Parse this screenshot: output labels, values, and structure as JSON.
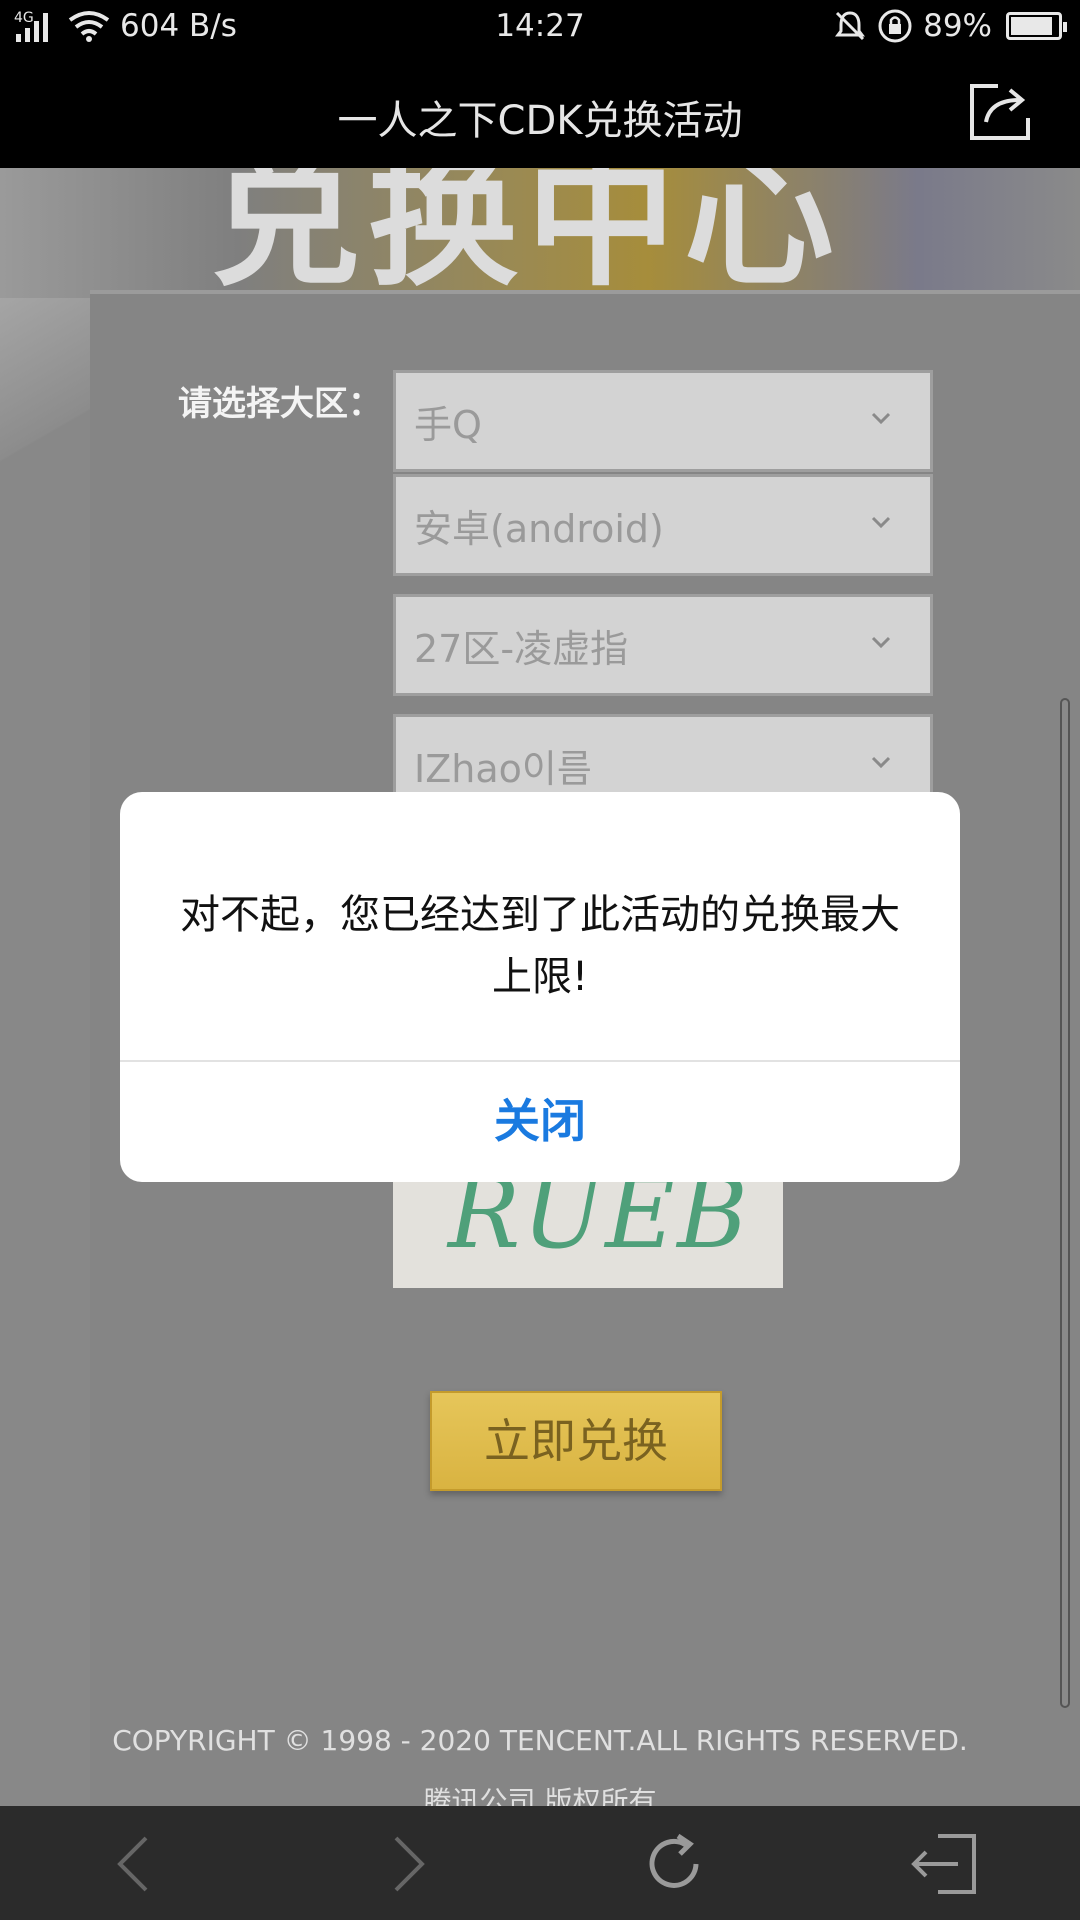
{
  "status_bar": {
    "network_type": "4G",
    "speed": "604 B/s",
    "time": "14:27",
    "battery_percent": "89%",
    "battery_level": 0.89,
    "icons": [
      "signal-icon",
      "wifi-icon",
      "mute-icon",
      "lock-rotation-icon",
      "battery-icon"
    ]
  },
  "title_bar": {
    "title": "一人之下CDK兑换活动",
    "share_icon": "share-icon"
  },
  "form": {
    "region_label": "请选择大区：",
    "selects": [
      {
        "value": "手Q"
      },
      {
        "value": "安卓(android)"
      },
      {
        "value": "27区-凌虚指"
      },
      {
        "value": "IZhao이름"
      }
    ],
    "captcha_text": "RUEB",
    "redeem_button": "立即兑换"
  },
  "footer": {
    "copyright": "COPYRIGHT © 1998 - 2020 TENCENT.ALL RIGHTS RESERVED.",
    "copyright_cn": "腾讯公司 版权所有"
  },
  "dialog": {
    "message": "对不起，您已经达到了此活动的兑换最大上限!",
    "close_label": "关闭",
    "close_color": "#1a7ae0"
  },
  "bottom_nav": {
    "items": [
      "back-icon",
      "forward-icon",
      "refresh-icon",
      "exit-icon"
    ]
  }
}
